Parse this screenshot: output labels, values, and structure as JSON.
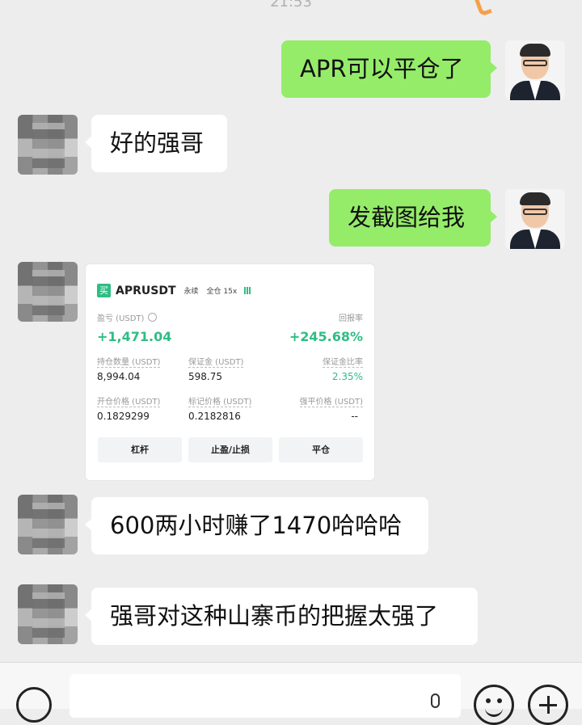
{
  "status": {
    "time": "21:53"
  },
  "messages": [
    {
      "from": "me",
      "text": "APR可以平仓了"
    },
    {
      "from": "friend",
      "text": "好的强哥"
    },
    {
      "from": "me",
      "text": "发截图给我"
    },
    {
      "from": "friend",
      "type": "image"
    },
    {
      "from": "friend",
      "text": "600两小时赚了1470哈哈哈"
    },
    {
      "from": "friend",
      "text": "强哥对这种山寨币的把握太强了"
    }
  ],
  "trade_card": {
    "side_tag": "买",
    "symbol": "APRUSDT",
    "contract_type": "永续",
    "margin_mode": "全仓 15x",
    "pnl_label": "盈亏 (USDT)",
    "pnl_value": "+1,471.04",
    "roi_label": "回报率",
    "roi_value": "+245.68%",
    "position_label": "持仓数量 (USDT)",
    "position_value": "8,994.04",
    "margin_label": "保证金 (USDT)",
    "margin_value": "598.75",
    "margin_ratio_label": "保证金比率",
    "margin_ratio_value": "2.35%",
    "entry_label": "开仓价格 (USDT)",
    "entry_value": "0.1829299",
    "mark_label": "标记价格 (USDT)",
    "mark_value": "0.2182816",
    "liq_label": "强平价格 (USDT)",
    "liq_value": "--",
    "buttons": [
      "杠杆",
      "止盈/止损",
      "平仓"
    ],
    "accent_color": "#2ebd85"
  },
  "input_bar": {
    "voice_icon": "voice-icon",
    "emoji_icon": "emoji-icon",
    "plus_icon": "plus-icon",
    "mic_icon": "mic-icon"
  }
}
